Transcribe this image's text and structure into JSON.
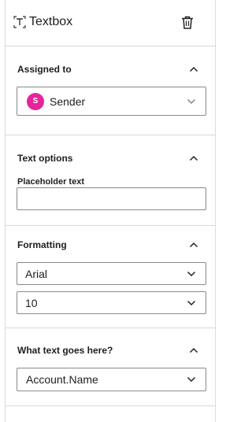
{
  "header": {
    "title": "Textbox",
    "icon": "textbox-icon",
    "delete_icon": "trash-icon"
  },
  "assigned": {
    "title": "Assigned to",
    "selected": "Sender",
    "avatar_initial": "S",
    "avatar_color": "#e6249b"
  },
  "text_options": {
    "title": "Text options",
    "placeholder_label": "Placeholder text",
    "placeholder_value": ""
  },
  "formatting": {
    "title": "Formatting",
    "font": "Arial",
    "size": "10"
  },
  "what_text": {
    "title": "What text goes here?",
    "value": "Account.Name"
  }
}
